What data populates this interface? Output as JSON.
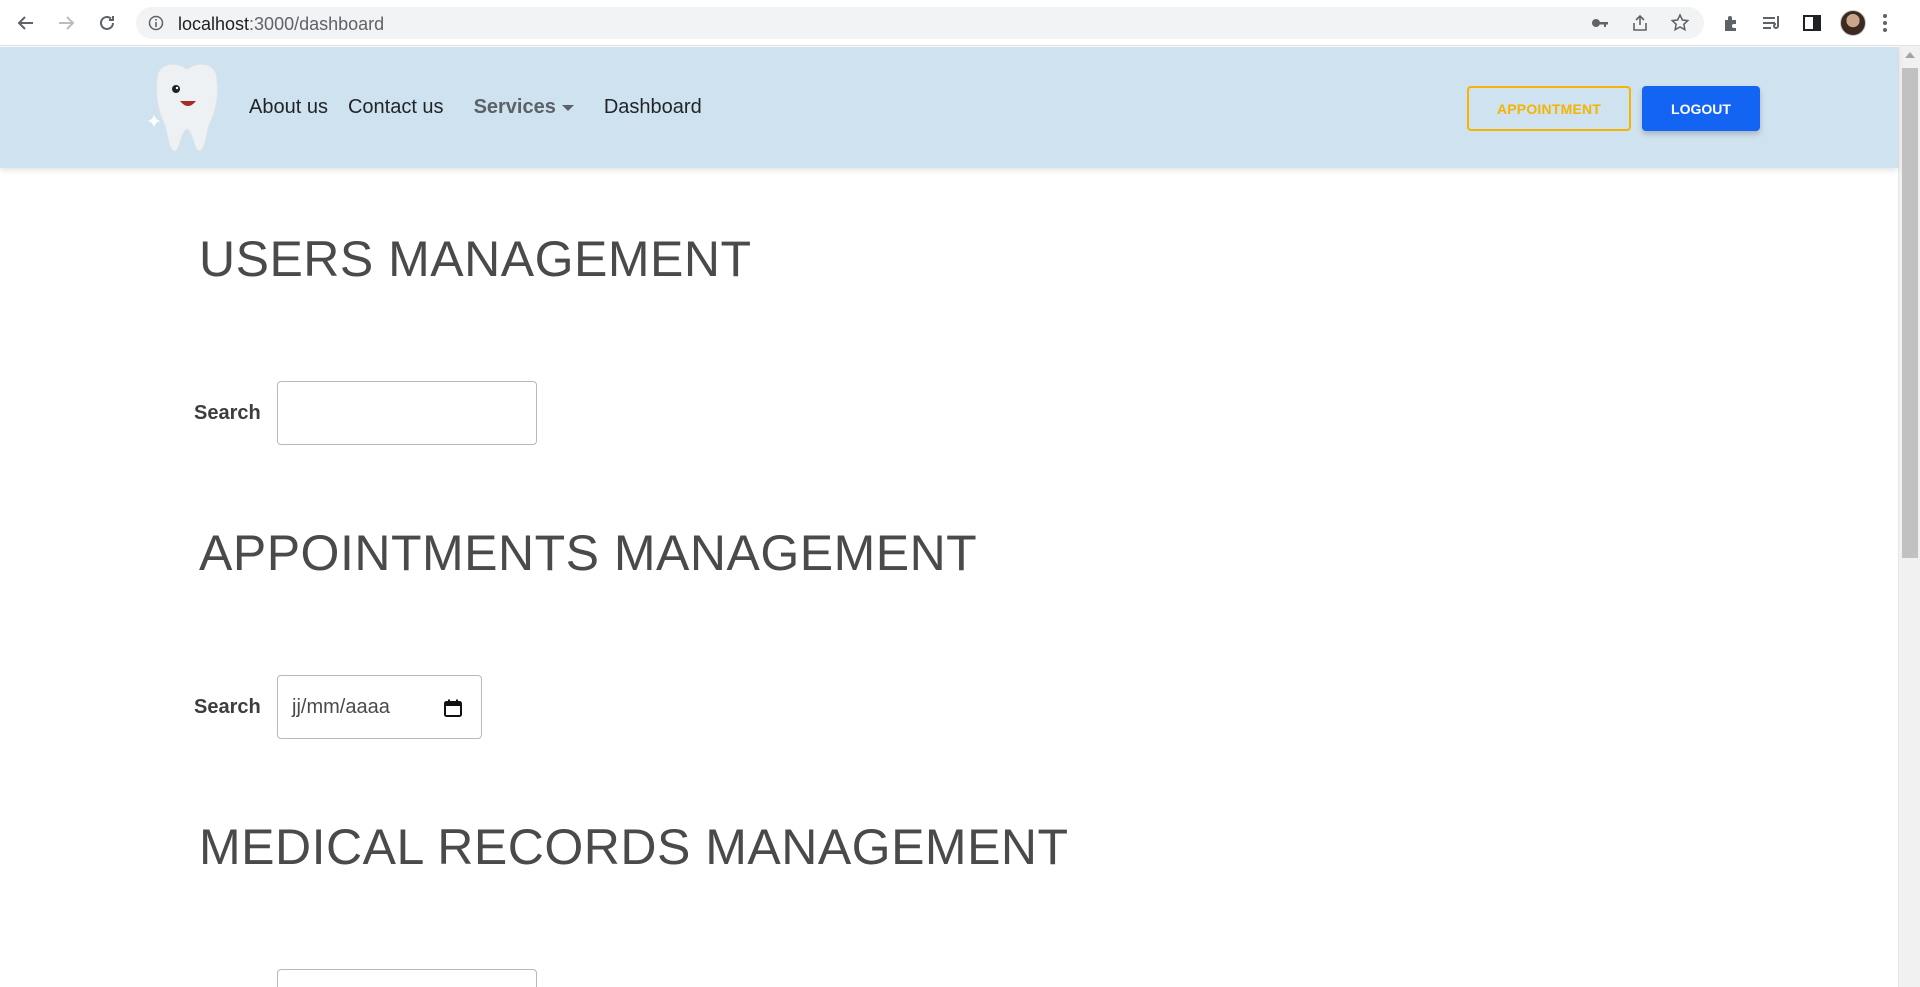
{
  "browser": {
    "url_host": "localhost",
    "url_rest": ":3000/dashboard"
  },
  "navbar": {
    "links": [
      "About us",
      "Contact us",
      "Services",
      "Dashboard"
    ],
    "appointment_label": "APPOINTMENT",
    "logout_label": "LOGOUT",
    "accent_color": "#f5b400",
    "primary_color": "#1464f4",
    "background_color": "#cfe2ef"
  },
  "sections": {
    "users_title": "USERS MANAGEMENT",
    "users_search_label": "Search",
    "users_search_value": "",
    "appointments_title": "APPOINTMENTS MANAGEMENT",
    "appointments_search_label": "Search",
    "appointments_date_placeholder": "jj/mm/aaaa",
    "records_title": "MEDICAL RECORDS MANAGEMENT"
  }
}
